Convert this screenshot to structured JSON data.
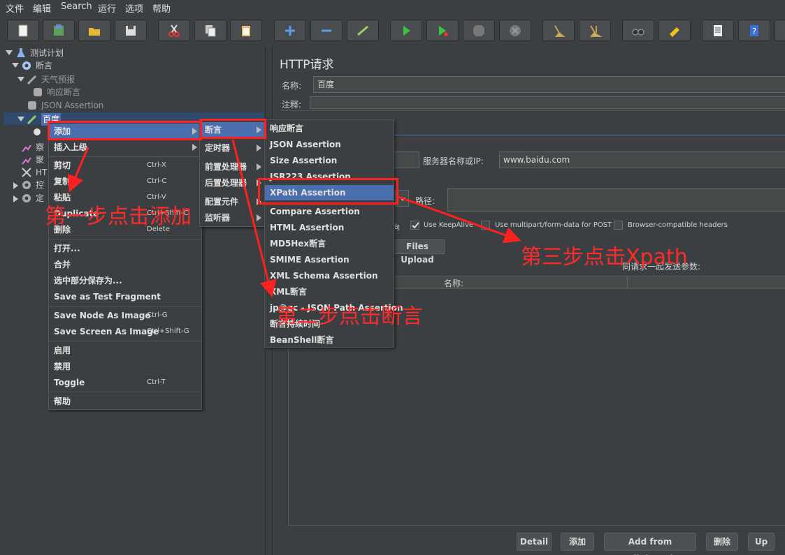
{
  "menubar": [
    "文件",
    "编辑",
    "Search",
    "运行",
    "选项",
    "帮助"
  ],
  "toolbar": [
    "new-icon",
    "templates-icon",
    "open-icon",
    "save-icon",
    "cut-icon",
    "copy-icon",
    "paste-icon",
    "expand-icon",
    "collapse-icon",
    "toggle-icon",
    "start-icon",
    "start-no-pause-icon",
    "stop-icon",
    "shutdown-icon",
    "clear-icon",
    "clear-all-icon",
    "search-icon",
    "reset-search-icon",
    "function-helper-icon",
    "help-icon"
  ],
  "tree": {
    "test_plan": "测试计划",
    "assertion_group": "断言",
    "weather": "天气预报",
    "response_assertion": "响应断言",
    "json_assertion": "JSON Assertion",
    "baidu": "百度",
    "observe": "察",
    "aggregate": "聚",
    "http": "HT",
    "control": "控",
    "timer": "定"
  },
  "context_menu": {
    "items": [
      "添加",
      "插入上级",
      "剪切",
      "复制",
      "粘贴",
      "Duplicate",
      "删除",
      "打开...",
      "合并",
      "选中部分保存为...",
      "Save as Test Fragment",
      "Save Node As Image",
      "Save Screen As Image",
      "启用",
      "禁用",
      "Toggle",
      "帮助"
    ],
    "shortcuts": {
      "cut": "Ctrl-X",
      "copy": "Ctrl-C",
      "paste": "Ctrl-V",
      "duplicate": "Ctrl+Shift-C",
      "delete": "Delete",
      "save_node": "Ctrl-G",
      "save_screen": "Ctrl+Shift-G",
      "toggle": "Ctrl-T"
    }
  },
  "add_submenu": [
    "断言",
    "定时器",
    "前置处理器",
    "后置处理器",
    "配置元件",
    "监听器"
  ],
  "assertion_submenu": [
    "响应断言",
    "JSON Assertion",
    "Size Assertion",
    "JSR223 Assertion",
    "XPath Assertion",
    "Compare Assertion",
    "HTML Assertion",
    "MD5Hex断言",
    "SMIME Assertion",
    "XML Schema Assertion",
    "XML断言",
    "jp@gc - JSON Path Assertion",
    "断言持续时间",
    "BeanShell断言"
  ],
  "panel": {
    "title": "HTTP请求",
    "name_label": "名称:",
    "name_value": "百度",
    "comment_label": "注释:",
    "server_label": "服务器名称或IP:",
    "server_value": "www.baidu.com",
    "path_label": "路径:",
    "keepalive": "Use KeepAlive",
    "multipart": "Use multipart/form-data for POST",
    "browser_headers": "Browser-compatible headers",
    "redirect_partial": "向",
    "tab_files": "Files Upload",
    "params_title": "同请求一起发送参数:",
    "col_name": "名称:",
    "buttons": [
      "Detail",
      "添加",
      "Add from Clipboard",
      "删除",
      "Up"
    ]
  },
  "annotations": {
    "step1": "第一步点击添加",
    "step2": "第二步点击断言",
    "step3": "第三步点击Xpath"
  },
  "colors": {
    "annotation": "#ff2020",
    "highlight": "#4b6eaf",
    "background": "#3c3f41"
  }
}
